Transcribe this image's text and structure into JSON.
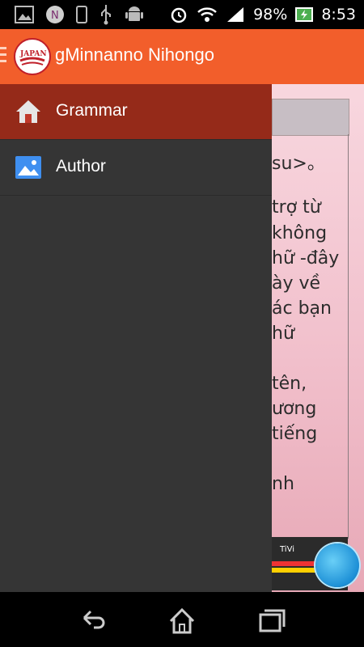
{
  "status_bar": {
    "battery_percent": "98%",
    "time": "8:53",
    "icons": [
      "picture-icon",
      "notification-n-icon",
      "phone-icon",
      "usb-icon",
      "android-icon",
      "alarm-icon",
      "wifi-icon",
      "signal-icon",
      "battery-icon"
    ]
  },
  "app_bar": {
    "title": "gMinnanno Nihongo",
    "logo_text": "JAPAN",
    "colors": {
      "app_bar": "#f25e2b",
      "selected_item": "#952a19",
      "drawer": "#353535"
    }
  },
  "drawer": {
    "items": [
      {
        "label": "Grammar",
        "icon": "home-icon",
        "selected": true
      },
      {
        "label": "Author",
        "icon": "image-icon",
        "selected": false
      }
    ]
  },
  "content": {
    "visible_lines": [
      "su>。",
      "trợ từ",
      "không",
      "hữ -đây",
      "ày về",
      "ác bạn",
      "hữ",
      "tên,",
      "ương",
      "tiếng",
      "nh"
    ]
  },
  "ad": {
    "text": "TiVi"
  },
  "nav_bar": {
    "buttons": [
      "back-icon",
      "home-nav-icon",
      "recents-icon"
    ]
  }
}
